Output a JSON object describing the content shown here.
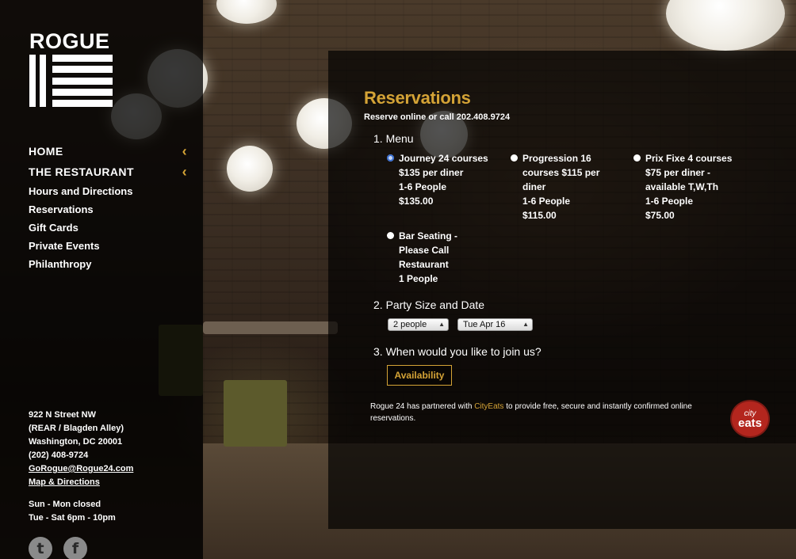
{
  "brand": {
    "name": "ROGUE"
  },
  "nav": {
    "main": [
      {
        "label": "HOME"
      },
      {
        "label": "THE RESTAURANT"
      }
    ],
    "chevron": "‹",
    "sub": [
      {
        "label": "Hours and Directions"
      },
      {
        "label": "Reservations"
      },
      {
        "label": "Gift Cards"
      },
      {
        "label": "Private Events"
      },
      {
        "label": "Philanthropy"
      }
    ]
  },
  "address": {
    "line1": "922 N Street NW",
    "line2": "(REAR / Blagden Alley)",
    "line3": "Washington, DC 20001",
    "phone": "(202) 408-9724",
    "email": "GoRogue@Rogue24.com",
    "map_link": "Map & Directions",
    "hours1": "Sun - Mon closed",
    "hours2": "Tue - Sat 6pm - 10pm"
  },
  "social": {
    "twitter": "t",
    "facebook": "f"
  },
  "reservations": {
    "title": "Reservations",
    "subtitle": "Reserve online or call 202.408.9724",
    "step1": "1. Menu",
    "options": [
      {
        "desc": "Journey 24 courses $135 per diner",
        "people": "1-6 People",
        "price": "$135.00",
        "selected": true
      },
      {
        "desc": "Progression 16 courses $115 per diner",
        "people": "1-6 People",
        "price": "$115.00",
        "selected": false
      },
      {
        "desc": "Prix Fixe 4 courses $75 per diner - available T,W,Th",
        "people": "1-6 People",
        "price": "$75.00",
        "selected": false
      },
      {
        "desc": "Bar Seating - Please Call Restaurant",
        "people": "1 People",
        "price": "",
        "selected": false
      }
    ],
    "step2": "2. Party Size and Date",
    "party_size": "2 people",
    "date": "Tue Apr 16",
    "step3": "3. When would you like to join us?",
    "availability_button": "Availability",
    "partner_text_before": "Rogue 24 has partnered with ",
    "partner_link": "CityEats",
    "partner_text_after": " to provide free, secure and instantly confirmed online reservations.",
    "partner_logo_line1": "city",
    "partner_logo_line2": "eats"
  },
  "colors": {
    "accent": "#d4a336",
    "panel": "rgba(0,0,0,0.68)",
    "cityeats": "#b3261e"
  }
}
